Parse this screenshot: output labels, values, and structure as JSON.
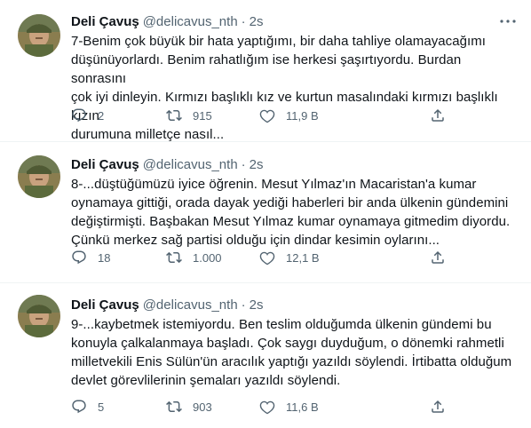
{
  "colors": {
    "text": "#0f1419",
    "secondary": "#536471",
    "divider": "#eff3f4"
  },
  "tweets": [
    {
      "name": "Deli Çavuş",
      "handle": "@delicavus_nth",
      "dot": "·",
      "time": "2s",
      "text": "7-Benim çok büyük bir hata yaptığımı, bir daha tahliye olamayacağımı\ndüşünüyorlardı. Benim rahatlığım ise herkesi şaşırtıyordu. Burdan sonrasını\nçok iyi dinleyin. Kırmızı başlıklı kız ve kurtun masalındaki kırmızı başlıklı kızın\ndurumuna milletçe nasıl...",
      "replies": "2",
      "retweets": "915",
      "likes": "11,9 B"
    },
    {
      "name": "Deli Çavuş",
      "handle": "@delicavus_nth",
      "dot": "·",
      "time": "2s",
      "text": "8-...düştüğümüzü iyice öğrenin. Mesut Yılmaz'ın Macaristan'a kumar\noynamaya gittiği, orada dayak yediği haberleri bir anda ülkenin gündemini\ndeğiştirmişti. Başbakan Mesut Yılmaz kumar oynamaya gitmedim diyordu.\nÇünkü merkez sağ partisi olduğu için dindar kesimin oylarını...",
      "replies": "18",
      "retweets": "1.000",
      "likes": "12,1 B"
    },
    {
      "name": "Deli Çavuş",
      "handle": "@delicavus_nth",
      "dot": "·",
      "time": "2s",
      "text": "9-...kaybetmek istemiyordu. Ben teslim olduğumda ülkenin gündemi bu\nkonuyla çalkalanmaya başladı. Çok saygı duyduğum, o dönemki rahmetli\nmilletvekili Enis Sülün'ün aracılık yaptığı yazıldı söylendi. İrtibatta olduğum\ndevlet görevlilerinin şemaları yazıldı söylendi.",
      "replies": "5",
      "retweets": "903",
      "likes": "11,6 B"
    }
  ]
}
